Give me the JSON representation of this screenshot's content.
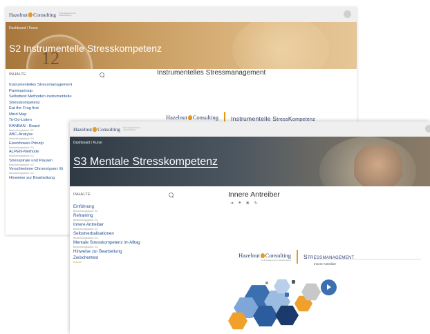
{
  "brand": {
    "name_first": "Hazelnut",
    "name_second": "Consulting",
    "tagline": "Profi-Akademie für Weiterbildung"
  },
  "back_window": {
    "breadcrumb": "Dashboard / Kurse",
    "course_title": "S2 Instrumentelle Stresskompetenz",
    "toc_heading": "INHALTE",
    "content_title": "Instrumentelles Stressmanagement",
    "slide_title_big": "Instrumentelle S",
    "slide_title_rest": "tress",
    "slide_title_big2": "K",
    "slide_title_rest2": "ompetenz",
    "toc": [
      {
        "label": "Instrumentelles Stressmanagement",
        "sub": ""
      },
      {
        "label": "Paretoprinzip",
        "sub": ""
      },
      {
        "label": "Selbsttest Methoden instrumentelle",
        "sub": ""
      },
      {
        "label": "Stresskompetenz",
        "sub": ""
      },
      {
        "label": "Eat the Frog first",
        "sub": ""
      },
      {
        "label": "Mind Map",
        "sub": ""
      },
      {
        "label": "To-Do-Listen",
        "sub": ""
      },
      {
        "label": "KANBAN - Board",
        "sub": "Bearbeitungsstand: 0/1"
      },
      {
        "label": "ABC-Analyse",
        "sub": "Bearbeitungsstand: 0/1"
      },
      {
        "label": "Eisenhower-Prinzip",
        "sub": "Bearbeitungsstand: 0/1"
      },
      {
        "label": "ALPEN-Methode",
        "sub": "Bearbeitungsstand: 0/1"
      },
      {
        "label": "Stresspiraie und Pausen",
        "sub": "Bearbeitungsstand: 0/1"
      },
      {
        "label": "Verschiedene Chronotypen: Ei",
        "sub": "Bearbeitungsstand: 0/1"
      },
      {
        "label": "Hinweise zur Bearbeitung",
        "sub": ""
      }
    ]
  },
  "front_window": {
    "breadcrumb": "Dashboard / Kurse",
    "course_title": "S3 Mentale Stresskompetenz",
    "toc_heading": "INHALTE",
    "content_title": "Innere Antreiber",
    "slide_title": "Stressmanagement",
    "slide_subtitle": "Innere Antreiber",
    "nav_icons": [
      "arrow-right",
      "circle",
      "close",
      "refresh"
    ],
    "toc": [
      {
        "label": "Einführung",
        "sub": "Bearbeitungsstand: 0/1"
      },
      {
        "label": "Reframing",
        "sub": "Bearbeitungsstand: 0/1"
      },
      {
        "label": "Innere Antreiber",
        "sub": "Bearbeitungsstand: 0/1"
      },
      {
        "label": "Selbstverbalisationen",
        "sub": "Bearbeitungsstand: 0/1"
      },
      {
        "label": "Mentale Stresskompetenz im Alltag",
        "sub": "Bearbeitungsstand: 0/1"
      },
      {
        "label": "Hinweise zur Bearbeitung",
        "sub": ""
      },
      {
        "label": "Zwischentest",
        "sub": "Entwurf"
      }
    ]
  },
  "colors": {
    "link": "#1f4f8f",
    "brand_navy": "#2b3d6b",
    "accent_orange": "#e69a1c",
    "hex_blue": "#3b6fb0",
    "hex_navy": "#1b3a6b",
    "hex_orange": "#f0a02b",
    "hex_grey": "#c8c8c8"
  }
}
